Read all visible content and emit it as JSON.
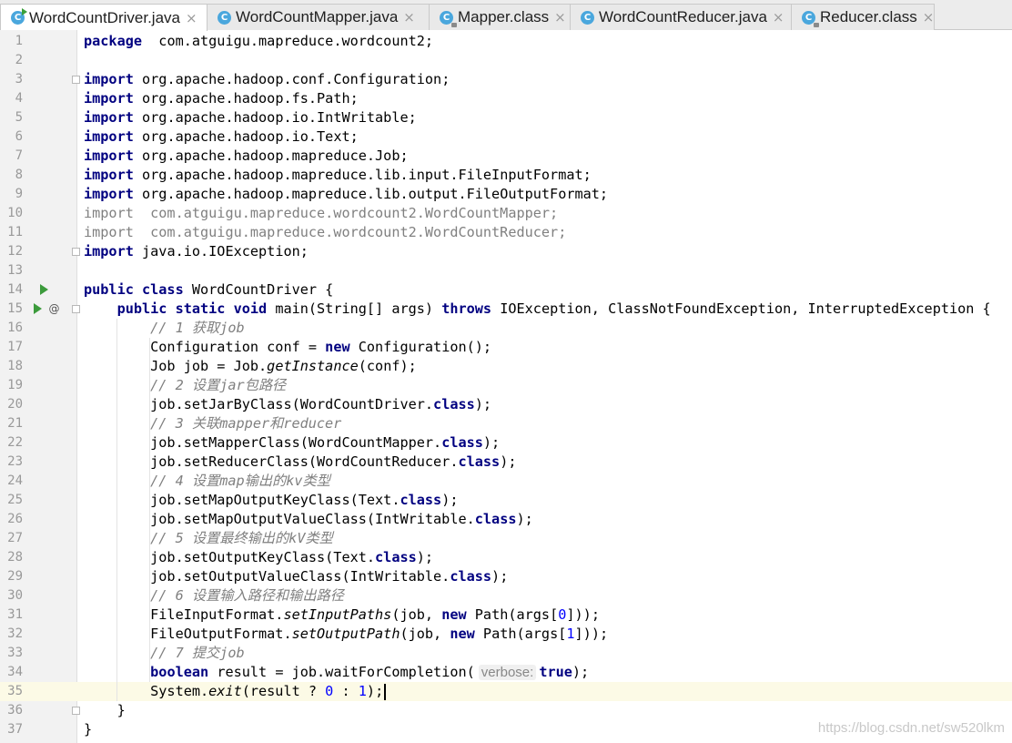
{
  "tabs": [
    {
      "label": "WordCountDriver.java",
      "icon": "C",
      "active": true
    },
    {
      "label": "WordCountMapper.java",
      "icon": "C",
      "active": false
    },
    {
      "label": "Mapper.class",
      "icon": "C",
      "active": false
    },
    {
      "label": "WordCountReducer.java",
      "icon": "C",
      "active": false
    },
    {
      "label": "Reducer.class",
      "icon": "C",
      "active": false
    }
  ],
  "close_glyph": "×",
  "override_glyph": "@",
  "current_line": 35,
  "lines": [
    [
      [
        "k",
        "package"
      ],
      [
        "",
        "  com.atguigu.mapreduce.wordcount2;"
      ]
    ],
    [],
    [
      [
        "k",
        "import"
      ],
      [
        "",
        " org.apache.hadoop.conf.Configuration;"
      ]
    ],
    [
      [
        "k",
        "import"
      ],
      [
        "",
        " org.apache.hadoop.fs.Path;"
      ]
    ],
    [
      [
        "k",
        "import"
      ],
      [
        "",
        " org.apache.hadoop.io.IntWritable;"
      ]
    ],
    [
      [
        "k",
        "import"
      ],
      [
        "",
        " org.apache.hadoop.io.Text;"
      ]
    ],
    [
      [
        "k",
        "import"
      ],
      [
        "",
        " org.apache.hadoop.mapreduce.Job;"
      ]
    ],
    [
      [
        "k",
        "import"
      ],
      [
        "",
        " org.apache.hadoop.mapreduce.lib.input.FileInputFormat;"
      ]
    ],
    [
      [
        "k",
        "import"
      ],
      [
        "",
        " org.apache.hadoop.mapreduce.lib.output.FileOutputFormat;"
      ]
    ],
    [
      [
        "unused",
        "import  com.atguigu.mapreduce.wordcount2.WordCountMapper;"
      ]
    ],
    [
      [
        "unused",
        "import  com.atguigu.mapreduce.wordcount2.WordCountReducer;"
      ]
    ],
    [
      [
        "k",
        "import"
      ],
      [
        "",
        " java.io.IOException;"
      ]
    ],
    [],
    [
      [
        "k",
        "public class"
      ],
      [
        "",
        " WordCountDriver {"
      ]
    ],
    [
      [
        "",
        "    "
      ],
      [
        "k",
        "public static void"
      ],
      [
        "",
        " main(String[] args) "
      ],
      [
        "k",
        "throws"
      ],
      [
        "",
        " IOException, ClassNotFoundException, InterruptedException {"
      ]
    ],
    [
      [
        "",
        "        "
      ],
      [
        "cmt",
        "// 1 获取job"
      ]
    ],
    [
      [
        "",
        "        Configuration conf = "
      ],
      [
        "k",
        "new"
      ],
      [
        "",
        " Configuration();"
      ]
    ],
    [
      [
        "",
        "        Job job = Job."
      ],
      [
        "i",
        "getInstance"
      ],
      [
        "",
        "(conf);"
      ]
    ],
    [
      [
        "",
        "        "
      ],
      [
        "cmt",
        "// 2 设置jar包路径"
      ]
    ],
    [
      [
        "",
        "        job.setJarByClass(WordCountDriver."
      ],
      [
        "k",
        "class"
      ],
      [
        "",
        ");"
      ]
    ],
    [
      [
        "",
        "        "
      ],
      [
        "cmt",
        "// 3 关联mapper和reducer"
      ]
    ],
    [
      [
        "",
        "        job.setMapperClass(WordCountMapper."
      ],
      [
        "k",
        "class"
      ],
      [
        "",
        ");"
      ]
    ],
    [
      [
        "",
        "        job.setReducerClass(WordCountReducer."
      ],
      [
        "k",
        "class"
      ],
      [
        "",
        ");"
      ]
    ],
    [
      [
        "",
        "        "
      ],
      [
        "cmt",
        "// 4 设置map输出的kv类型"
      ]
    ],
    [
      [
        "",
        "        job.setMapOutputKeyClass(Text."
      ],
      [
        "k",
        "class"
      ],
      [
        "",
        ");"
      ]
    ],
    [
      [
        "",
        "        job.setMapOutputValueClass(IntWritable."
      ],
      [
        "k",
        "class"
      ],
      [
        "",
        ");"
      ]
    ],
    [
      [
        "",
        "        "
      ],
      [
        "cmt",
        "// 5 设置最终输出的kV类型"
      ]
    ],
    [
      [
        "",
        "        job.setOutputKeyClass(Text."
      ],
      [
        "k",
        "class"
      ],
      [
        "",
        ");"
      ]
    ],
    [
      [
        "",
        "        job.setOutputValueClass(IntWritable."
      ],
      [
        "k",
        "class"
      ],
      [
        "",
        ");"
      ]
    ],
    [
      [
        "",
        "        "
      ],
      [
        "cmt",
        "// 6 设置输入路径和输出路径"
      ]
    ],
    [
      [
        "",
        "        FileInputFormat."
      ],
      [
        "i",
        "setInputPaths"
      ],
      [
        "",
        "(job, "
      ],
      [
        "k",
        "new"
      ],
      [
        "",
        " Path(args["
      ],
      [
        "num",
        "0"
      ],
      [
        "",
        "]));"
      ]
    ],
    [
      [
        "",
        "        FileOutputFormat."
      ],
      [
        "i",
        "setOutputPath"
      ],
      [
        "",
        "(job, "
      ],
      [
        "k",
        "new"
      ],
      [
        "",
        " Path(args["
      ],
      [
        "num",
        "1"
      ],
      [
        "",
        "]));"
      ]
    ],
    [
      [
        "",
        "        "
      ],
      [
        "cmt",
        "// 7 提交job"
      ]
    ],
    [
      [
        "",
        "        "
      ],
      [
        "k",
        "boolean"
      ],
      [
        "",
        " result = job.waitForCompletion("
      ],
      [
        "hint",
        "verbose:"
      ],
      [
        "k",
        "true"
      ],
      [
        "",
        ");"
      ]
    ],
    [
      [
        "",
        "        System."
      ],
      [
        "i",
        "exit"
      ],
      [
        "",
        "(result ? "
      ],
      [
        "num",
        "0"
      ],
      [
        "",
        " : "
      ],
      [
        "num",
        "1"
      ],
      [
        "",
        ");"
      ],
      [
        "caret",
        ""
      ]
    ],
    [
      [
        "",
        "    }"
      ]
    ],
    [
      [
        "",
        "}"
      ]
    ]
  ],
  "watermark": "https://blog.csdn.net/sw520lkm"
}
